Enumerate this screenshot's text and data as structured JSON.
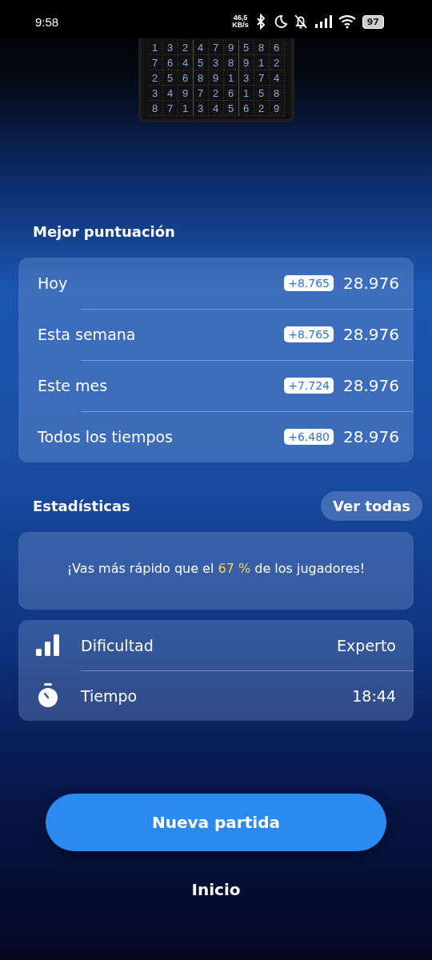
{
  "status_bar": {
    "time": "9:58",
    "net_speed": "46,5",
    "net_unit": "KB/s",
    "battery": "97"
  },
  "board": {
    "rows": [
      [
        "1",
        "3",
        "2",
        "4",
        "7",
        "9",
        "5",
        "8",
        "6"
      ],
      [
        "7",
        "6",
        "4",
        "5",
        "3",
        "8",
        "9",
        "1",
        "2"
      ],
      [
        "2",
        "5",
        "6",
        "8",
        "9",
        "1",
        "3",
        "7",
        "4"
      ],
      [
        "3",
        "4",
        "9",
        "7",
        "2",
        "6",
        "1",
        "5",
        "8"
      ],
      [
        "8",
        "7",
        "1",
        "3",
        "4",
        "5",
        "6",
        "2",
        "9"
      ]
    ]
  },
  "best_score": {
    "title": "Mejor puntuación",
    "rows": [
      {
        "label": "Hoy",
        "gain": "+8.765",
        "score": "28.976"
      },
      {
        "label": "Esta semana",
        "gain": "+8.765",
        "score": "28.976"
      },
      {
        "label": "Este mes",
        "gain": "+7.724",
        "score": "28.976"
      },
      {
        "label": "Todos los tiempos",
        "gain": "+6.480",
        "score": "28.976"
      }
    ]
  },
  "statistics": {
    "title": "Estadísticas",
    "see_all": "Ver todas",
    "message": {
      "before": "¡Vas más rápido que el",
      "highlight": "67 %",
      "after": "de los jugadores!"
    },
    "details": [
      {
        "kind": "difficulty",
        "label": "Dificultad",
        "value": "Experto"
      },
      {
        "kind": "time",
        "label": "Tiempo",
        "value": "18:44"
      }
    ]
  },
  "new_game": "Nueva partida",
  "home": "Inicio"
}
